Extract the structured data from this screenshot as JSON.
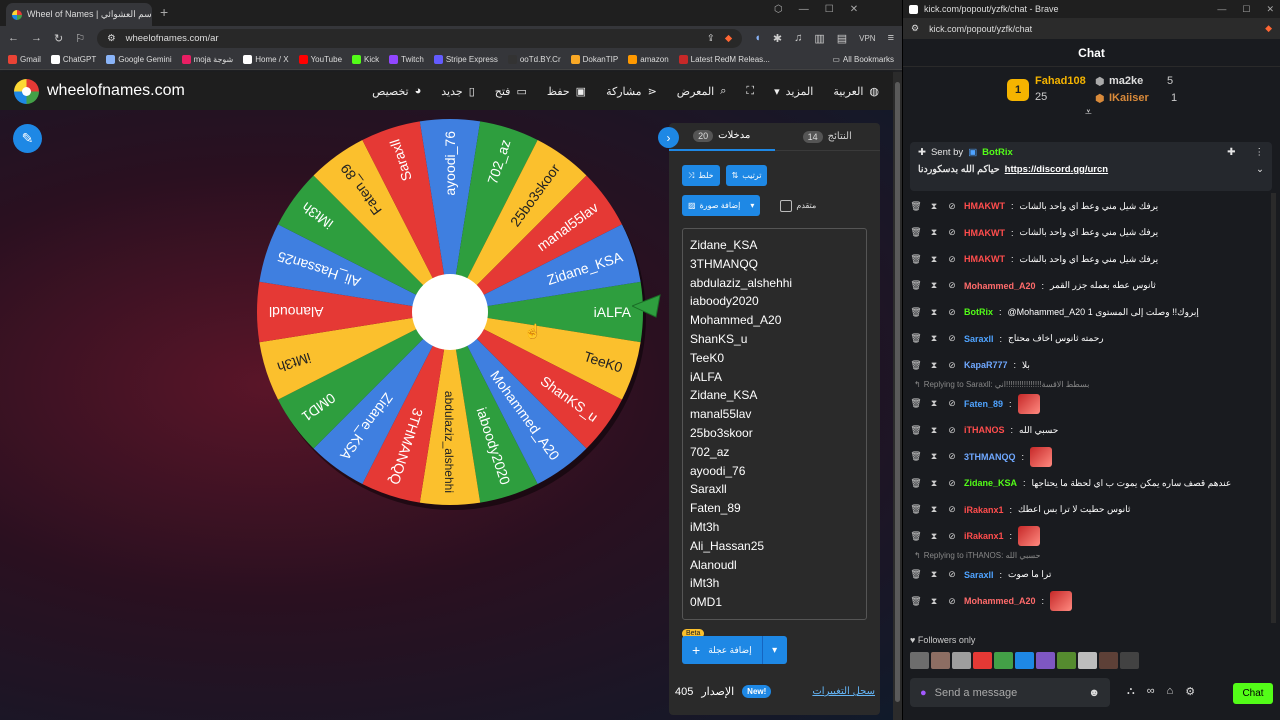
{
  "left_window": {
    "tab_title": "Wheel of Names | عجلة الاسم العشوائي",
    "url": "wheelofnames.com/ar",
    "vpn": "VPN",
    "bookmarks": [
      {
        "label": "Gmail",
        "color": "#ea4335"
      },
      {
        "label": "ChatGPT",
        "color": "#ffffff"
      },
      {
        "label": "Google Gemini",
        "color": "#8ab4f8"
      },
      {
        "label": "moja شوجة",
        "color": "#e91e63"
      },
      {
        "label": "Home / X",
        "color": "#ffffff"
      },
      {
        "label": "YouTube",
        "color": "#ff0000"
      },
      {
        "label": "Kick",
        "color": "#53fc18"
      },
      {
        "label": "Twitch",
        "color": "#9146ff"
      },
      {
        "label": "Stripe Express",
        "color": "#635bff"
      },
      {
        "label": "ooTd.BY.Cr",
        "color": "#333333"
      },
      {
        "label": "DokanTIP",
        "color": "#f9a825"
      },
      {
        "label": "amazon",
        "color": "#ff9900"
      },
      {
        "label": "Latest RedM Releas...",
        "color": "#c62828"
      }
    ],
    "all_bookmarks": "All Bookmarks"
  },
  "site": {
    "brand": "wheelofnames.com",
    "nav": [
      "العربية",
      "المزيد",
      "",
      "المعرض",
      "مشاركة",
      "حفظ",
      "فتح",
      "جديد",
      "تخصيص"
    ]
  },
  "panel": {
    "tab_entries": "مدخلات",
    "entries_count": "20",
    "tab_results": "النتائج",
    "results_count": "14",
    "shuffle": "خلط",
    "sort": "ترتيب",
    "add_image": "إضافة صورة",
    "advanced": "متقدم",
    "entries": [
      "Zidane_KSA",
      "3THMANQQ",
      "abdulaziz_alshehhi",
      "iaboody2020",
      "Mohammed_A20",
      "ShanKS_u",
      "TeeK0",
      "iALFA",
      "Zidane_KSA",
      "manal55lav",
      "25bo3skoor",
      "702_az",
      "ayoodi_76",
      "Saraxll",
      "Faten_89",
      "iMt3h",
      "Ali_Hassan25",
      "Alanoudl",
      "iMt3h",
      "0MD1"
    ],
    "beta": "Beta",
    "add_wheel": "إضافة عجلة",
    "version_label": "الإصدار",
    "version": "405",
    "new_badge": "New!",
    "changelog": "سجل التغييرات"
  },
  "wheel": {
    "slices": [
      "iALFA",
      "TeeK0",
      "ShanKS_u",
      "Mohammed_A20",
      "iaboody2020",
      "abdulaziz_alshehhi",
      "3THMANQQ",
      "Zidane_KSA",
      "0MD1",
      "iMt3h",
      "Alanoudl",
      "Ali_Hassan25",
      "iMt3h",
      "Faten_89",
      "Saraxll",
      "ayoodi_76",
      "702_az",
      "25bo3skoor",
      "manal55lav",
      "Zidane_KSA"
    ],
    "colors": [
      "#2e9e3e",
      "#fbc02d",
      "#e53935",
      "#3f7fe0"
    ]
  },
  "right_window": {
    "title": "kick.com/popout/yzfk/chat - Brave",
    "url": "kick.com/popout/yzfk/chat",
    "chat_title": "Chat",
    "leaderboard": [
      {
        "name": "Fahad108",
        "value": "25"
      },
      {
        "name": "ma2ke",
        "value": "5"
      },
      {
        "name": "IKaiiser",
        "value": "1"
      }
    ],
    "pinned": {
      "sent_by": "Sent by",
      "bot": "BotRix",
      "text": "حياكم الله بدسكوردنا",
      "link": "https://discord.gg/urcn"
    },
    "messages": [
      {
        "user": "HMAKWT",
        "color": "#ff4d4d",
        "text": "يرفك شيل مني وعط اي واحد بالشات"
      },
      {
        "user": "HMAKWT",
        "color": "#ff4d4d",
        "text": "يرفك شيل مني وعط اي واحد بالشات"
      },
      {
        "user": "HMAKWT",
        "color": "#ff4d4d",
        "text": "يرفك شيل مني وعط اي واحد بالشات"
      },
      {
        "user": "Mohammed_A20",
        "color": "#ff6b6b",
        "text": "ثانوس عطه بعمله جزر القمر"
      },
      {
        "user": "BotRix",
        "color": "#53fc18",
        "text": "@Mohammed_A20 إبروك!! وصلت إلى المستوى 1"
      },
      {
        "user": "Saraxll",
        "color": "#4fa3ff",
        "text": "رحمته ثانوس اخاف محتاج"
      },
      {
        "user": "KapaR777",
        "color": "#6fa8ff",
        "text": "بلا"
      },
      {
        "reply": "Replying to Saraxll: بسطط الاقسة!!!!!!!!!!!!!!!!اني"
      },
      {
        "user": "Faten_89",
        "color": "#4fa3ff",
        "text": ""
      },
      {
        "user": "iTHANOS",
        "color": "#ff4d4d",
        "text": "حسبي الله"
      },
      {
        "user": "3THMANQQ",
        "color": "#6fa8ff",
        "text": ""
      },
      {
        "user": "Zidane_KSA",
        "color": "#53fc18",
        "text": "عندهم قصف ساره يمكن يموت ب اي لحظة ما يحتاجها"
      },
      {
        "user": "iRakanx1",
        "color": "#ff4d4d",
        "text": "ثانوس حطيت لا ترا بس اعطك"
      },
      {
        "user": "iRakanx1",
        "color": "#ff4d4d",
        "text": ""
      },
      {
        "reply": "Replying to iTHANOS: حسبي الله"
      },
      {
        "user": "Saraxll",
        "color": "#4fa3ff",
        "text": "ترا ما صوت"
      },
      {
        "user": "Mohammed_A20",
        "color": "#ff6b6b",
        "text": ""
      }
    ],
    "followers_only": "Followers only",
    "input_placeholder": "Send a message",
    "chat_button": "Chat"
  }
}
